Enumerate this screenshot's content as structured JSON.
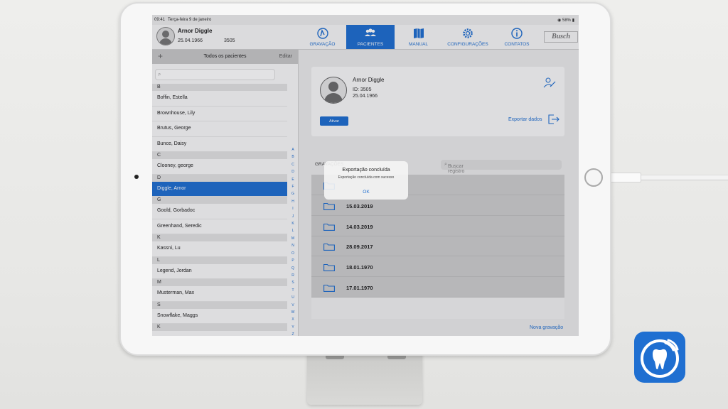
{
  "status": {
    "time": "09:41",
    "date": "Terça-feira 9 de janeiro",
    "battery": "58%"
  },
  "header": {
    "patient_name": "Arnor Diggle",
    "patient_dob": "25.04.1966",
    "patient_id": "3505",
    "logo": "Busch",
    "nav": [
      {
        "label": "GRAVAÇÃO",
        "icon": "recording-icon",
        "active": false
      },
      {
        "label": "PACIENTES",
        "icon": "patients-icon",
        "active": true
      },
      {
        "label": "MANUAL",
        "icon": "manual-icon",
        "active": false
      },
      {
        "label": "CONFIGURAÇÕES",
        "icon": "gear-icon",
        "active": false
      },
      {
        "label": "CONTATOS",
        "icon": "info-icon",
        "active": false
      }
    ]
  },
  "sidebar": {
    "title": "Todos os pacientes",
    "edit_label": "Editar",
    "add_label": "+",
    "search_placeholder": "",
    "entries": [
      {
        "type": "section",
        "label": "B"
      },
      {
        "type": "patient",
        "label": "Boffin, Estella"
      },
      {
        "type": "patient",
        "label": "Brownhouse, Lily"
      },
      {
        "type": "patient",
        "label": "Brutus, George"
      },
      {
        "type": "patient",
        "label": "Bunce, Daisy"
      },
      {
        "type": "section",
        "label": "C"
      },
      {
        "type": "patient",
        "label": "Clooney, george"
      },
      {
        "type": "section",
        "label": "D"
      },
      {
        "type": "patient",
        "label": "Diggle, Arnor",
        "selected": true
      },
      {
        "type": "section",
        "label": "G"
      },
      {
        "type": "patient",
        "label": "Goold, Gorbadoc"
      },
      {
        "type": "patient",
        "label": "Greenhand, Seredic"
      },
      {
        "type": "section",
        "label": "K"
      },
      {
        "type": "patient",
        "label": "Kassni, Lu"
      },
      {
        "type": "section",
        "label": "L"
      },
      {
        "type": "patient",
        "label": "Legend, Jordan"
      },
      {
        "type": "section",
        "label": "M"
      },
      {
        "type": "patient",
        "label": "Musterman, Max"
      },
      {
        "type": "section",
        "label": "S"
      },
      {
        "type": "patient",
        "label": "Snowflake, Maggs"
      },
      {
        "type": "section",
        "label": "K"
      }
    ],
    "alphabet": [
      "A",
      "B",
      "C",
      "D",
      "E",
      "F",
      "G",
      "H",
      "I",
      "J",
      "K",
      "L",
      "M",
      "N",
      "O",
      "P",
      "Q",
      "R",
      "S",
      "T",
      "U",
      "V",
      "W",
      "X",
      "Y",
      "Z"
    ]
  },
  "detail": {
    "name": "Arnor Diggle",
    "id_text": "ID: 3505",
    "dob": "25.04.1966",
    "activate_label": "Ativar",
    "export_label": "Exportar dados",
    "recordings_label": "GRAVAÇÕES",
    "recordings_search_placeholder": "Buscar registro",
    "recordings": [
      "",
      "15.03.2019",
      "14.03.2019",
      "28.09.2017",
      "18.01.1970",
      "17.01.1970"
    ],
    "new_recording_label": "Nova gravação"
  },
  "alert": {
    "title": "Exportação concluída",
    "message": "Exportação concluída com sucesso",
    "ok_label": "OK"
  },
  "colors": {
    "accent": "#1f6fd1"
  }
}
